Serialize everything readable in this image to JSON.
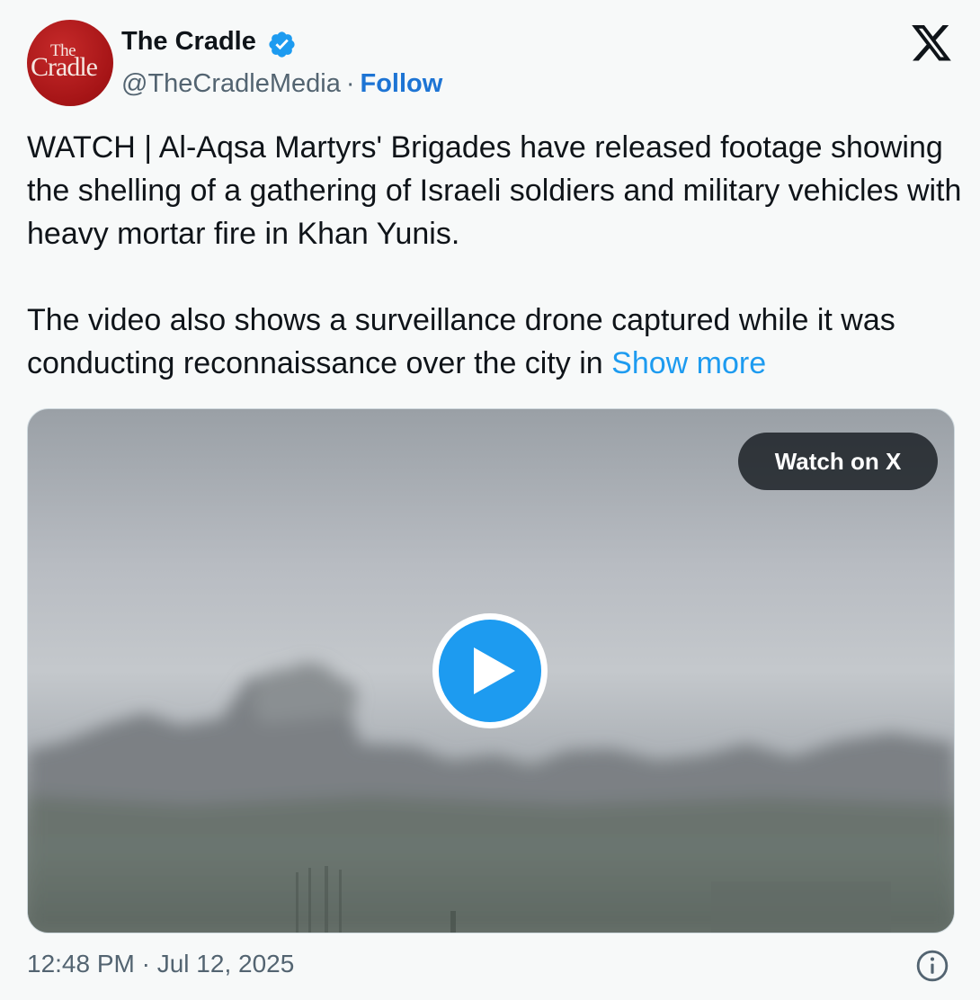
{
  "author": {
    "name": "The Cradle",
    "handle": "@TheCradleMedia",
    "separator": "·",
    "follow_label": "Follow",
    "avatar_logo_top": "The",
    "avatar_logo_main": "Cradle",
    "verified_icon": "verified-badge-icon"
  },
  "platform_icon": "x-logo-icon",
  "tweet": {
    "paragraph_1": "WATCH | Al-Aqsa Martyrs' Brigades have released footage showing the shelling of a gathering of Israeli soldiers and military vehicles with heavy mortar fire in Khan Yunis.",
    "paragraph_2": "The video also shows a surveillance drone captured while it was conducting reconnaissance over the city in",
    "show_more_label": "Show more"
  },
  "media": {
    "watch_label": "Watch on X",
    "play_icon": "play-icon"
  },
  "footer": {
    "timestamp": "12:48 PM · Jul 12, 2025",
    "info_icon": "info-icon"
  },
  "colors": {
    "link": "#1d9bf0",
    "follow": "#1d74d4",
    "secondary_text": "#536471",
    "background": "#f7f9f9",
    "avatar": "#a51416"
  }
}
